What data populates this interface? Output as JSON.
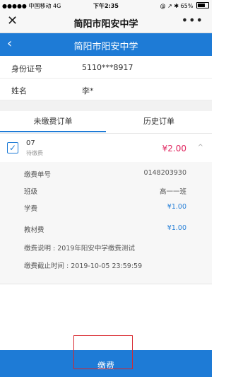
{
  "status_bar": {
    "carrier": "●●●●● 中国移动  4G",
    "time": "下午2:35",
    "battery_text": "@ ↗ ✱ 65%"
  },
  "wechat_nav": {
    "close_glyph": "✕",
    "title": "简阳市阳安中学",
    "more_glyph": "•••"
  },
  "header": {
    "back_glyph": "‹",
    "title": "简阳市阳安中学"
  },
  "student": {
    "id_label": "身份证号",
    "id_value": "5110***8917",
    "name_label": "姓名",
    "name_value": "李*"
  },
  "tabs": [
    {
      "label": "未缴费订单",
      "active": true
    },
    {
      "label": "历史订单",
      "active": false
    }
  ],
  "order": {
    "checked_glyph": "✓",
    "number": "07",
    "status": "待缴费",
    "amount": "¥2.00",
    "collapse_glyph": "^",
    "details": [
      {
        "key": "缴费单号",
        "value": "0148203930"
      },
      {
        "key": "班级",
        "value": "高一一班"
      },
      {
        "key": "学费",
        "value": "¥1.00"
      },
      {
        "key": "教材费",
        "value": "¥1.00"
      }
    ],
    "note": "缴费说明 : 2019年阳安中学缴费测试",
    "deadline": "缴费截止时间 : 2019-10-05 23:59:59"
  },
  "pay_button": {
    "label": "缴费"
  },
  "colors": {
    "primary": "#1e7bd6",
    "amount": "#e0245e",
    "highlight": "#d8252b"
  }
}
